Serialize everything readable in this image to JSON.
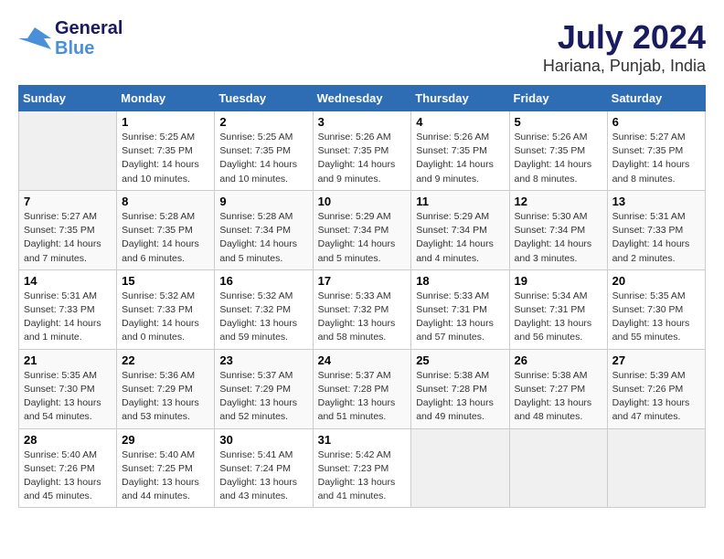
{
  "header": {
    "logo_line1": "General",
    "logo_line2": "Blue",
    "month_year": "July 2024",
    "location": "Hariana, Punjab, India"
  },
  "days_of_week": [
    "Sunday",
    "Monday",
    "Tuesday",
    "Wednesday",
    "Thursday",
    "Friday",
    "Saturday"
  ],
  "weeks": [
    [
      {
        "day": "",
        "info": ""
      },
      {
        "day": "1",
        "info": "Sunrise: 5:25 AM\nSunset: 7:35 PM\nDaylight: 14 hours\nand 10 minutes."
      },
      {
        "day": "2",
        "info": "Sunrise: 5:25 AM\nSunset: 7:35 PM\nDaylight: 14 hours\nand 10 minutes."
      },
      {
        "day": "3",
        "info": "Sunrise: 5:26 AM\nSunset: 7:35 PM\nDaylight: 14 hours\nand 9 minutes."
      },
      {
        "day": "4",
        "info": "Sunrise: 5:26 AM\nSunset: 7:35 PM\nDaylight: 14 hours\nand 9 minutes."
      },
      {
        "day": "5",
        "info": "Sunrise: 5:26 AM\nSunset: 7:35 PM\nDaylight: 14 hours\nand 8 minutes."
      },
      {
        "day": "6",
        "info": "Sunrise: 5:27 AM\nSunset: 7:35 PM\nDaylight: 14 hours\nand 8 minutes."
      }
    ],
    [
      {
        "day": "7",
        "info": "Sunrise: 5:27 AM\nSunset: 7:35 PM\nDaylight: 14 hours\nand 7 minutes."
      },
      {
        "day": "8",
        "info": "Sunrise: 5:28 AM\nSunset: 7:35 PM\nDaylight: 14 hours\nand 6 minutes."
      },
      {
        "day": "9",
        "info": "Sunrise: 5:28 AM\nSunset: 7:34 PM\nDaylight: 14 hours\nand 5 minutes."
      },
      {
        "day": "10",
        "info": "Sunrise: 5:29 AM\nSunset: 7:34 PM\nDaylight: 14 hours\nand 5 minutes."
      },
      {
        "day": "11",
        "info": "Sunrise: 5:29 AM\nSunset: 7:34 PM\nDaylight: 14 hours\nand 4 minutes."
      },
      {
        "day": "12",
        "info": "Sunrise: 5:30 AM\nSunset: 7:34 PM\nDaylight: 14 hours\nand 3 minutes."
      },
      {
        "day": "13",
        "info": "Sunrise: 5:31 AM\nSunset: 7:33 PM\nDaylight: 14 hours\nand 2 minutes."
      }
    ],
    [
      {
        "day": "14",
        "info": "Sunrise: 5:31 AM\nSunset: 7:33 PM\nDaylight: 14 hours\nand 1 minute."
      },
      {
        "day": "15",
        "info": "Sunrise: 5:32 AM\nSunset: 7:33 PM\nDaylight: 14 hours\nand 0 minutes."
      },
      {
        "day": "16",
        "info": "Sunrise: 5:32 AM\nSunset: 7:32 PM\nDaylight: 13 hours\nand 59 minutes."
      },
      {
        "day": "17",
        "info": "Sunrise: 5:33 AM\nSunset: 7:32 PM\nDaylight: 13 hours\nand 58 minutes."
      },
      {
        "day": "18",
        "info": "Sunrise: 5:33 AM\nSunset: 7:31 PM\nDaylight: 13 hours\nand 57 minutes."
      },
      {
        "day": "19",
        "info": "Sunrise: 5:34 AM\nSunset: 7:31 PM\nDaylight: 13 hours\nand 56 minutes."
      },
      {
        "day": "20",
        "info": "Sunrise: 5:35 AM\nSunset: 7:30 PM\nDaylight: 13 hours\nand 55 minutes."
      }
    ],
    [
      {
        "day": "21",
        "info": "Sunrise: 5:35 AM\nSunset: 7:30 PM\nDaylight: 13 hours\nand 54 minutes."
      },
      {
        "day": "22",
        "info": "Sunrise: 5:36 AM\nSunset: 7:29 PM\nDaylight: 13 hours\nand 53 minutes."
      },
      {
        "day": "23",
        "info": "Sunrise: 5:37 AM\nSunset: 7:29 PM\nDaylight: 13 hours\nand 52 minutes."
      },
      {
        "day": "24",
        "info": "Sunrise: 5:37 AM\nSunset: 7:28 PM\nDaylight: 13 hours\nand 51 minutes."
      },
      {
        "day": "25",
        "info": "Sunrise: 5:38 AM\nSunset: 7:28 PM\nDaylight: 13 hours\nand 49 minutes."
      },
      {
        "day": "26",
        "info": "Sunrise: 5:38 AM\nSunset: 7:27 PM\nDaylight: 13 hours\nand 48 minutes."
      },
      {
        "day": "27",
        "info": "Sunrise: 5:39 AM\nSunset: 7:26 PM\nDaylight: 13 hours\nand 47 minutes."
      }
    ],
    [
      {
        "day": "28",
        "info": "Sunrise: 5:40 AM\nSunset: 7:26 PM\nDaylight: 13 hours\nand 45 minutes."
      },
      {
        "day": "29",
        "info": "Sunrise: 5:40 AM\nSunset: 7:25 PM\nDaylight: 13 hours\nand 44 minutes."
      },
      {
        "day": "30",
        "info": "Sunrise: 5:41 AM\nSunset: 7:24 PM\nDaylight: 13 hours\nand 43 minutes."
      },
      {
        "day": "31",
        "info": "Sunrise: 5:42 AM\nSunset: 7:23 PM\nDaylight: 13 hours\nand 41 minutes."
      },
      {
        "day": "",
        "info": ""
      },
      {
        "day": "",
        "info": ""
      },
      {
        "day": "",
        "info": ""
      }
    ]
  ]
}
